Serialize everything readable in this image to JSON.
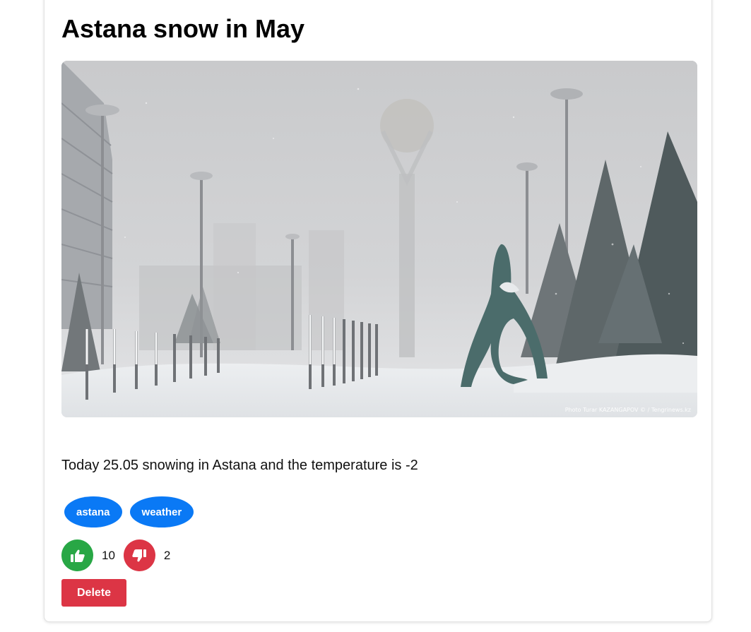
{
  "post": {
    "title": "Astana snow in May",
    "photo_credit": "Photo Turar KAZANGAPOV © / Tengrinews.kz",
    "text": "Today 25.05 snowing in Astana and the temperature is -2",
    "tags": [
      "astana",
      "weather"
    ],
    "likes": "10",
    "dislikes": "2",
    "delete_label": "Delete"
  },
  "colors": {
    "tag": "#0a79f5",
    "like": "#28a745",
    "dislike": "#dc3545",
    "delete": "#dc3545"
  },
  "icons": {
    "like": "thumbs-up-icon",
    "dislike": "thumbs-down-icon"
  }
}
